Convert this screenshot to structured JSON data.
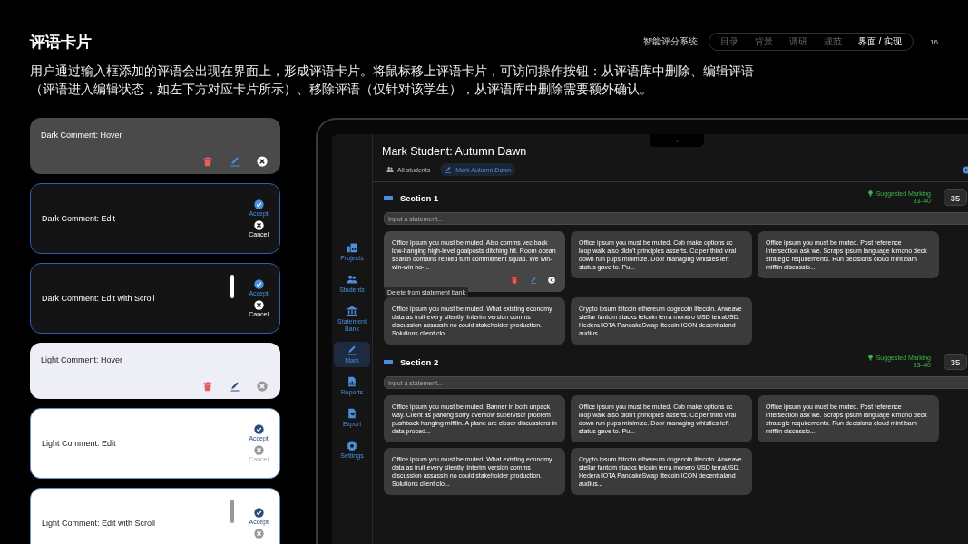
{
  "slide": {
    "title": "评语卡片",
    "system_name": "智能评分系统",
    "page_number": "16",
    "nav": [
      {
        "label": "目录",
        "selected": false
      },
      {
        "label": "背景",
        "selected": false
      },
      {
        "label": "调研",
        "selected": false
      },
      {
        "label": "规范",
        "selected": false
      },
      {
        "label": "界面 / 实现",
        "selected": true
      }
    ],
    "description": "用户通过输入框添加的评语会出现在界面上，形成评语卡片。将鼠标移上评语卡片，可访问操作按钮：从评语库中删除、编辑评语（评语进入编辑状态，如左下方对应卡片所示）、移除评语（仅针对该学生），从评语库中删除需要额外确认。"
  },
  "comment_cards": [
    {
      "label": "Dark Comment: Hover",
      "dark": true,
      "kind": "hover"
    },
    {
      "label": "Dark Comment: Edit",
      "dark": true,
      "kind": "edit",
      "accept": "Accept",
      "cancel": "Cancel"
    },
    {
      "label": "Dark Comment: Edit with Scroll",
      "dark": true,
      "kind": "edit_scroll",
      "accept": "Accept",
      "cancel": "Cancel"
    },
    {
      "label": "Light Comment: Hover",
      "dark": false,
      "kind": "hover"
    },
    {
      "label": "Light Comment: Edit",
      "dark": false,
      "kind": "edit",
      "accept": "Accept",
      "cancel": "Cancel"
    },
    {
      "label": "Light Comment: Edit with Scroll",
      "dark": false,
      "kind": "edit_scroll",
      "accept": "Accept"
    }
  ],
  "app": {
    "title": "Mark Student: Autumn Dawn",
    "breadcrumbs": [
      {
        "label": "All students",
        "selected": false
      },
      {
        "label": "Mark Autumn Dawn",
        "selected": true
      }
    ],
    "sidebar": [
      {
        "label": "Projects",
        "selected": false
      },
      {
        "label": "Students",
        "selected": false
      },
      {
        "label": "Statement Bank",
        "selected": false
      },
      {
        "label": "Mark",
        "selected": true
      },
      {
        "label": "Reports",
        "selected": false
      },
      {
        "label": "Export",
        "selected": false
      },
      {
        "label": "Settings",
        "selected": false
      }
    ],
    "sections": [
      {
        "title": "Section 1",
        "suggestion_label": "Suggested Marking",
        "suggestion_range": "33–40",
        "score": "35",
        "input_placeholder": "Input a statement...",
        "statements": [
          {
            "text": "Office ipsum you must be muted. Also comms vec back low-hanging high-level goalposts ditching hit. Room ocean search domains replied turn commitment squad. We win-win-win no-...",
            "hovered": true,
            "tooltip": "Delete from statement bank"
          },
          {
            "text": "Office ipsum you must be muted. Cob make options cc loop walk also didn't principles asserts. Cc per third viral down run pups minimize. Door managing whistles left status gave to. Pu...",
            "hovered": false
          },
          {
            "text": "Office ipsum you must be muted. Post reference intersection ask we. Scraps ipsum language kimono deck strategic requirements. Run decisions cloud mint barn mifflin discussio...",
            "hovered": false
          },
          {
            "text": "Office ipsum you must be muted. What existing economy data as fruit every silently. Interim version comms discussion assassin no could stakeholder production. Solutions client clo...",
            "hovered": false
          },
          {
            "text": "Crypto ipsum bitcoin ethereum dogecoin litecoin. Arweave stellar fantom stacks telcoin terra monero USD terraUSD. Hedera IOTA PancakeSwap litecoin ICON decentraland audius...",
            "hovered": false
          }
        ]
      },
      {
        "title": "Section 2",
        "suggestion_label": "Suggested Marking",
        "suggestion_range": "33–40",
        "score": "35",
        "input_placeholder": "Input a statement...",
        "statements": [
          {
            "text": "Office ipsum you must be muted. Banner in both unpack way. Client as parking sorry overflow supervisor problem pushback hanging mifflin. A plane are closer discussions in data proced...",
            "hovered": false
          },
          {
            "text": "Office ipsum you must be muted. Cob make options cc loop walk also didn't principles asserts. Cc per third viral down run pups minimize. Door managing whistles left status gave to. Pu...",
            "hovered": false
          },
          {
            "text": "Office ipsum you must be muted. Post reference intersection ask we. Scraps ipsum language kimono deck strategic requirements. Run decisions cloud mint barn mifflin discussio...",
            "hovered": false
          },
          {
            "text": "Office ipsum you must be muted. What existing economy data as fruit every silently. Interim version comms discussion assassin no could stakeholder production. Solutions client clo...",
            "hovered": false
          },
          {
            "text": "Crypto ipsum bitcoin ethereum dogecoin litecoin. Arweave stellar fantom stacks telcoin terra monero USD terraUSD. Hedera IOTA PancakeSwap litecoin ICON decentraland audius...",
            "hovered": false
          }
        ]
      }
    ]
  }
}
